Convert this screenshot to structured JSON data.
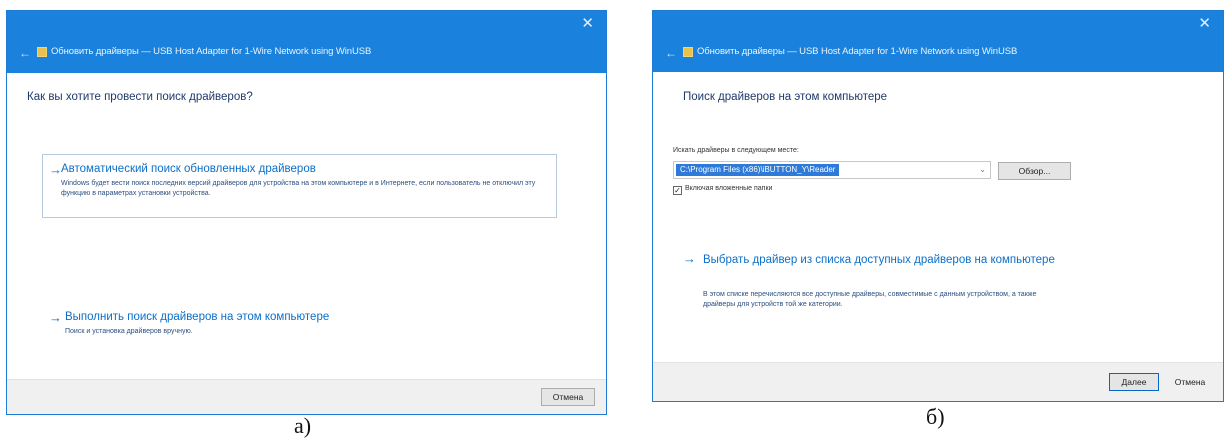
{
  "dialog_a": {
    "window_title": "Обновить драйверы — USB Host Adapter for 1-Wire Network using WinUSB",
    "close_icon": "close-icon",
    "back_icon": "back-arrow-icon",
    "heading": "Как вы хотите провести поиск драйверов?",
    "auto_option": {
      "title": "Автоматический поиск обновленных драйверов",
      "description": "Windows будет вести поиск последних версий драйверов для устройства на этом компьютере и в Интернете, если пользователь не отключил эту функцию в параметрах установки устройства."
    },
    "manual_option": {
      "title": "Выполнить поиск драйверов на этом компьютере",
      "description": "Поиск и установка драйверов вручную."
    },
    "cancel_label": "Отмена"
  },
  "dialog_b": {
    "window_title": "Обновить драйверы — USB Host Adapter for 1-Wire Network using WinUSB",
    "close_icon": "close-icon",
    "back_icon": "back-arrow-icon",
    "heading": "Поиск драйверов на этом компьютере",
    "search_label": "Искать драйверы в следующем месте:",
    "path_value": "C:\\Program Files (x86)\\iBUTTON_Y\\Reader",
    "browse_label": "Обзор...",
    "include_subfolders_label": "Включая вложенные папки",
    "include_subfolders_checked": true,
    "pick_option": {
      "title": "Выбрать драйвер из списка доступных драйверов на компьютере",
      "description": "В этом списке перечисляются все доступные драйверы, совместимые с данным устройством, а также драйверы для устройств той же категории."
    },
    "next_label": "Далее",
    "cancel_label": "Отмена"
  },
  "captions": {
    "a": "а)",
    "b": "б)"
  },
  "colors": {
    "titlebar": "#1a82dc",
    "link": "#0c6fc9",
    "heading": "#1f3a6a",
    "selection": "#2e7ad8"
  }
}
